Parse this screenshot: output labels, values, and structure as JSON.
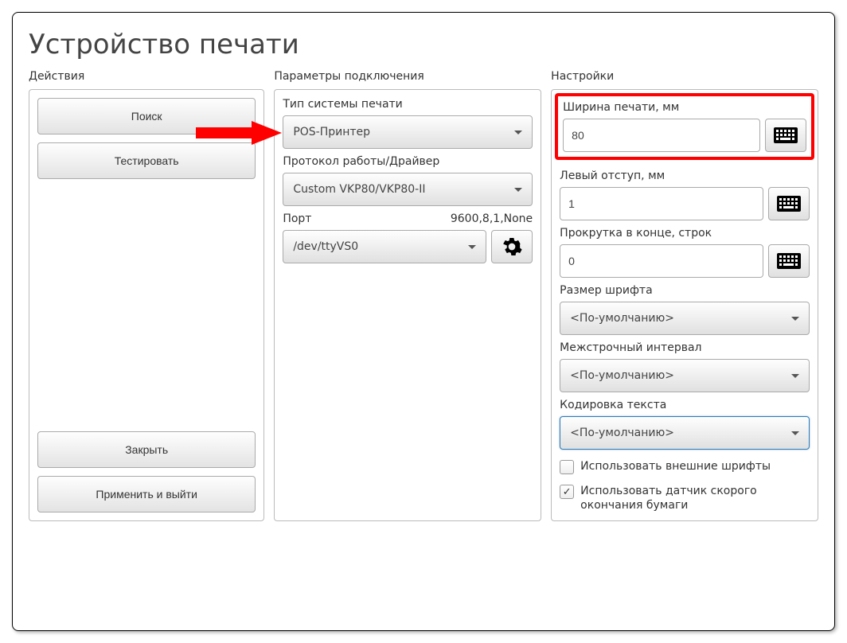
{
  "page_title": "Устройство печати",
  "sections": {
    "actions": "Действия",
    "params": "Параметры подключения",
    "settings": "Настройки"
  },
  "actions": {
    "search": "Поиск",
    "test": "Тестировать",
    "close": "Закрыть",
    "apply_exit": "Применить и выйти"
  },
  "params": {
    "print_system_type_label": "Тип системы печати",
    "print_system_type_value": "POS-Принтер",
    "driver_label": "Протокол работы/Драйвер",
    "driver_value": "Custom VKP80/VKP80-II",
    "port_label": "Порт",
    "port_extra": "9600,8,1,None",
    "port_value": "/dev/ttyVS0"
  },
  "settings": {
    "print_width_label": "Ширина печати, мм",
    "print_width_value": "80",
    "left_margin_label": "Левый отступ, мм",
    "left_margin_value": "1",
    "scroll_end_label": "Прокрутка в конце, строк",
    "scroll_end_value": "0",
    "font_size_label": "Размер шрифта",
    "font_size_value": "<По-умолчанию>",
    "line_spacing_label": "Межстрочный интервал",
    "line_spacing_value": "<По-умолчанию>",
    "encoding_label": "Кодировка текста",
    "encoding_value": "<По-умолчанию>",
    "use_external_fonts": "Использовать внешние шрифты",
    "use_paper_sensor": "Использовать датчик скорого окончания бумаги",
    "external_fonts_checked": false,
    "paper_sensor_checked": true
  }
}
